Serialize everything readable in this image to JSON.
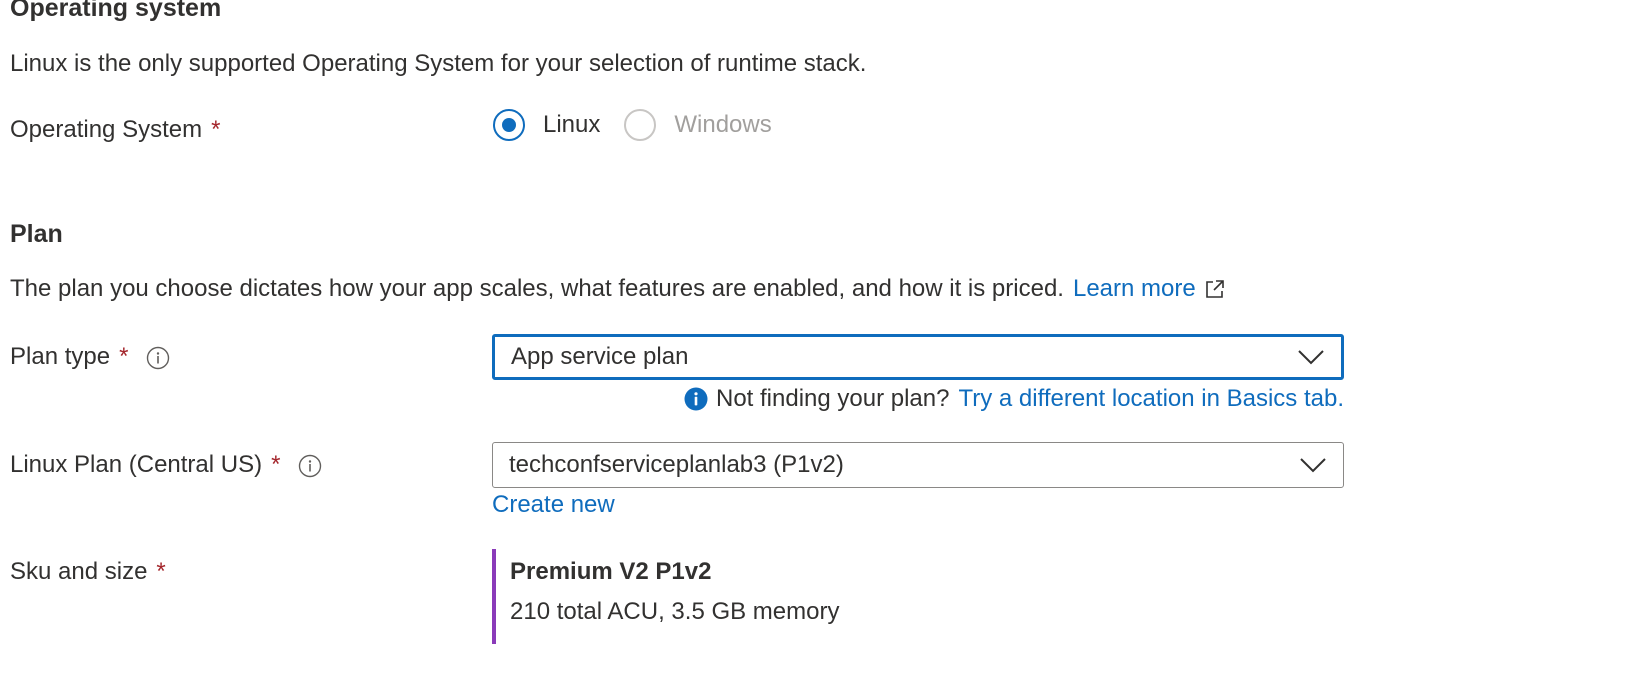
{
  "os_section": {
    "heading": "Operating system",
    "description": "Linux is the only supported Operating System for your selection of runtime stack.",
    "field_label": "Operating System",
    "required_marker": "*",
    "options": [
      {
        "label": "Linux",
        "selected": true,
        "disabled": false
      },
      {
        "label": "Windows",
        "selected": false,
        "disabled": true
      }
    ]
  },
  "plan_section": {
    "heading": "Plan",
    "description": "The plan you choose dictates how your app scales, what features are enabled, and how it is priced.",
    "learn_more": "Learn more",
    "plan_type": {
      "label": "Plan type",
      "required_marker": "*",
      "value": "App service plan"
    },
    "notice": {
      "text": "Not finding your plan?",
      "link": "Try a different location in Basics tab."
    },
    "linux_plan": {
      "label": "Linux Plan (Central US)",
      "required_marker": "*",
      "value": "techconfserviceplanlab3 (P1v2)",
      "create_new": "Create new"
    },
    "sku": {
      "label": "Sku and size",
      "required_marker": "*",
      "title": "Premium V2 P1v2",
      "detail": "210 total ACU, 3.5 GB memory"
    }
  },
  "colors": {
    "accent": "#0f6cbd",
    "required": "#a4262c",
    "sku_bar": "#8a3ab9",
    "text": "#323130",
    "disabled": "#a19f9d"
  }
}
